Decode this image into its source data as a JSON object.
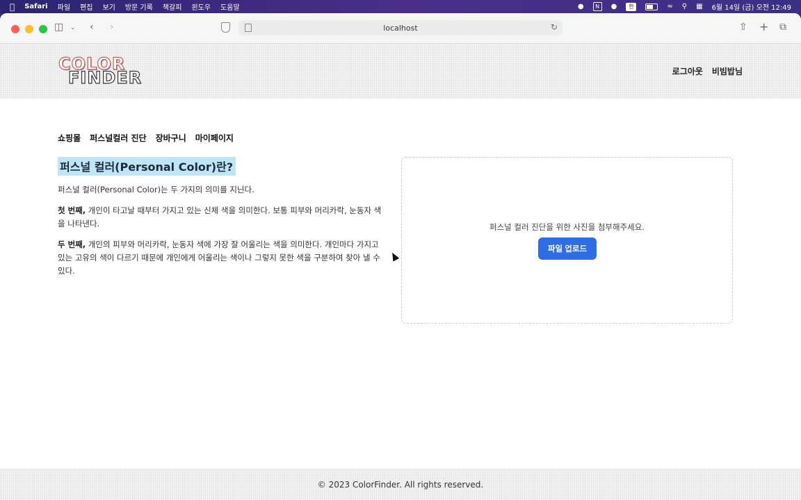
{
  "menubar": {
    "apple": "",
    "app": "Safari",
    "items": [
      "파일",
      "편집",
      "보기",
      "방문 기록",
      "책갈피",
      "윈도우",
      "도움말"
    ],
    "status_n": "N",
    "input_method": "한",
    "clock": "6월 14일 (금) 오전 12:49"
  },
  "browser": {
    "address": "localhost"
  },
  "site": {
    "logo": {
      "line1": "COLOR",
      "line2": "FINDER"
    },
    "header_links": [
      "로그아웃",
      "비빔밥님"
    ],
    "nav": [
      "쇼핑몰",
      "퍼스널컬러 진단",
      "장바구니",
      "마이페이지"
    ]
  },
  "intro": {
    "title": "퍼스널 컬러(Personal Color)란?",
    "p1": "퍼스널 컬러(Personal Color)는 두 가지의 의미를 지닌다.",
    "p2_bold": "첫 번째,",
    "p2_text": " 개인이 타고날 때부터 가지고 있는 신체 색을 의미한다. 보통 피부와 머리카락, 눈동자 색을 나타낸다.",
    "p3_bold": "두 번째,",
    "p3_text": " 개인의 피부와 머리카락, 눈동자 색에 가장 잘 어울리는 색을 의미한다. 개인마다 가지고 있는 고유의 색이 다르기 때문에 개인에게 어울리는 색이나 그렇지 못한 색을 구분하여 찾아 낼 수 있다."
  },
  "upload": {
    "prompt": "퍼스널 컬러 진단을 위한 사진을 첨부해주세요.",
    "button": "파일 업로드"
  },
  "footer": {
    "text": "© 2023 ColorFinder. All rights reserved."
  },
  "colors": {
    "accent": "#2e6de4",
    "title_highlight": "#bfe6f8"
  }
}
